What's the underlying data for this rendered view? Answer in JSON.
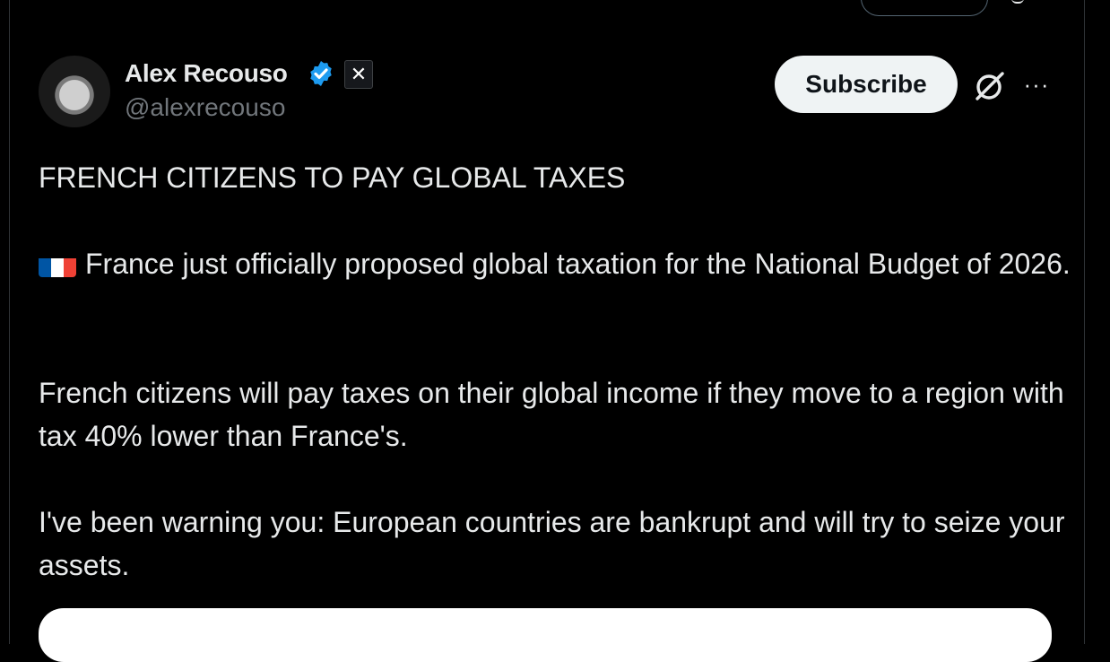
{
  "author": {
    "name": "Alex Recouso",
    "handle": "@alexrecouso",
    "badge_glyph": "✕"
  },
  "actions": {
    "subscribe_label": "Subscribe",
    "more_glyph": "···"
  },
  "post": {
    "headline": "FRENCH CITIZENS TO PAY GLOBAL TAXES",
    "paragraph_1": "France just officially proposed global taxation for the National Budget of 2026.",
    "paragraph_2": "French citizens will pay taxes on their global income if they move to a region with tax 40% lower than France's.",
    "paragraph_3": "I've been warning you: European countries are bankrupt and will try to seize your assets."
  },
  "icons": {
    "verified": "verified-badge-icon",
    "flag": "france-flag-icon",
    "grok": "grok-icon",
    "more": "more-icon"
  },
  "colors": {
    "background": "#000000",
    "text": "#e7e9ea",
    "muted": "#71767b",
    "verified_blue": "#1d9bf0",
    "button_bg": "#eff3f4",
    "flag_blue": "#0055a4",
    "flag_white": "#ffffff",
    "flag_red": "#ef4135"
  }
}
